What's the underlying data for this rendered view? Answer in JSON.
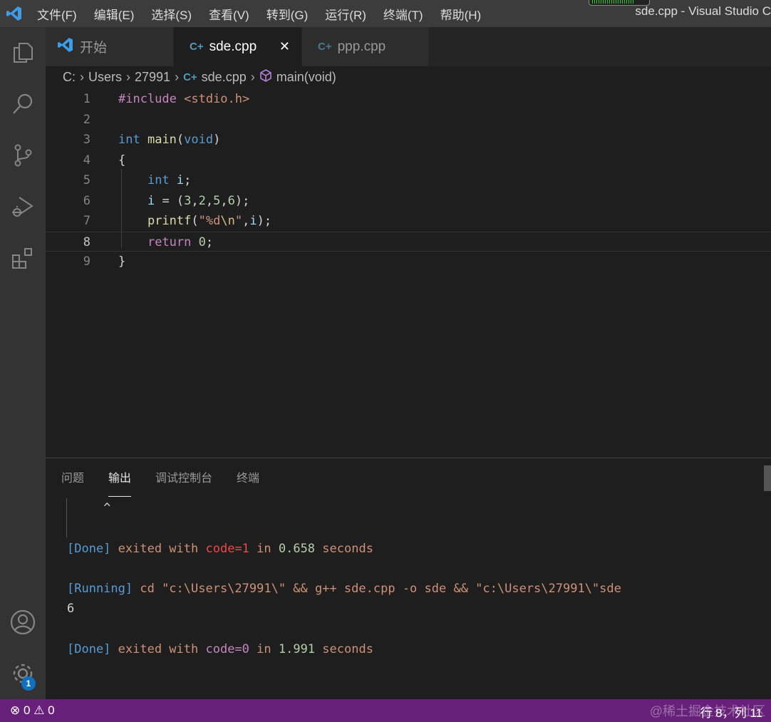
{
  "titlebar": {
    "menus": [
      "文件(F)",
      "编辑(E)",
      "选择(S)",
      "查看(V)",
      "转到(G)",
      "运行(R)",
      "终端(T)",
      "帮助(H)"
    ],
    "title": "sde.cpp - Visual Studio C"
  },
  "activity": {
    "icons": [
      "explorer-icon",
      "search-icon",
      "source-control-icon",
      "run-debug-icon",
      "extensions-icon",
      "account-icon",
      "settings-gear-icon"
    ],
    "settings_badge": "1"
  },
  "tabs": [
    {
      "label": "开始",
      "icon": "vscode-icon"
    },
    {
      "label": "sde.cpp",
      "icon": "cpp-icon",
      "close": "✕",
      "active": true
    },
    {
      "label": "ppp.cpp",
      "icon": "cpp-icon"
    }
  ],
  "breadcrumb": {
    "items": [
      "C:",
      "Users",
      "27991",
      "sde.cpp",
      "main(void)"
    ]
  },
  "editor": {
    "current_line": 8,
    "lines": [
      [
        [
          "#include ",
          "pp"
        ],
        [
          "<stdio.h>",
          "str"
        ]
      ],
      [],
      [
        [
          "int",
          "kw"
        ],
        [
          " ",
          ""
        ],
        [
          "main",
          "fn"
        ],
        [
          "(",
          ""
        ],
        [
          "void",
          "kw"
        ],
        [
          ")",
          ""
        ]
      ],
      [
        [
          "{",
          ""
        ]
      ],
      [
        [
          "    ",
          ""
        ],
        [
          "int",
          "kw"
        ],
        [
          " ",
          ""
        ],
        [
          "i",
          "var"
        ],
        [
          ";",
          ""
        ]
      ],
      [
        [
          "    ",
          ""
        ],
        [
          "i",
          "var"
        ],
        [
          " = (",
          ""
        ],
        [
          "3",
          "num"
        ],
        [
          ",",
          ""
        ],
        [
          "2",
          "num"
        ],
        [
          ",",
          ""
        ],
        [
          "5",
          "num"
        ],
        [
          ",",
          ""
        ],
        [
          "6",
          "num"
        ],
        [
          ");",
          ""
        ]
      ],
      [
        [
          "    ",
          ""
        ],
        [
          "printf",
          "fn"
        ],
        [
          "(",
          ""
        ],
        [
          "\"%d",
          "str"
        ],
        [
          "\\n",
          "esc"
        ],
        [
          "\"",
          "str"
        ],
        [
          ",",
          ""
        ],
        [
          "i",
          "var"
        ],
        [
          ");",
          ""
        ]
      ],
      [
        [
          "    ",
          ""
        ],
        [
          "return",
          "pp"
        ],
        [
          " ",
          ""
        ],
        [
          "0",
          "num"
        ],
        [
          ";",
          ""
        ]
      ],
      [
        [
          "}",
          ""
        ]
      ]
    ]
  },
  "panel": {
    "tabs": [
      "问题",
      "输出",
      "调试控制台",
      "终端"
    ],
    "active_tab": "输出",
    "output": [
      [
        [
          "     ^",
          "wht"
        ]
      ],
      [],
      [
        [
          "[Done]",
          "blue"
        ],
        [
          " exited with ",
          "o"
        ],
        [
          "code=1",
          "red"
        ],
        [
          " in ",
          "o"
        ],
        [
          "0.658",
          "grn"
        ],
        [
          " seconds",
          "o"
        ]
      ],
      [],
      [
        [
          "[Running]",
          "blue"
        ],
        [
          " cd \"c:\\Users\\27991\\\" && g++ sde.cpp -o sde && \"c:\\Users\\27991\\\"sde",
          "o"
        ]
      ],
      [
        [
          "6",
          "wht"
        ]
      ],
      [],
      [
        [
          "[Done]",
          "blue"
        ],
        [
          " exited with ",
          "o"
        ],
        [
          "code=0",
          "pur"
        ],
        [
          " in ",
          "o"
        ],
        [
          "1.991",
          "grn"
        ],
        [
          " seconds",
          "o"
        ]
      ]
    ]
  },
  "status": {
    "errors": "0",
    "warnings": "0",
    "position": "行 8，列 11",
    "watermark": "@稀土掘金技术社区"
  }
}
